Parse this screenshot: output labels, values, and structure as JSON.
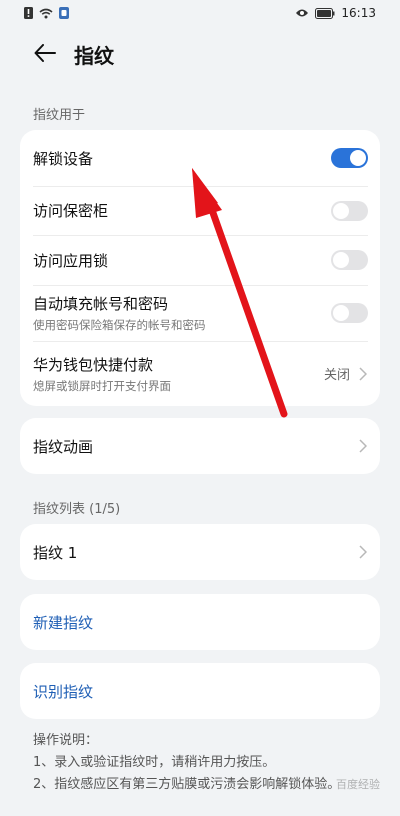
{
  "status_bar": {
    "time": "16:13",
    "left_icons": [
      "alert-icon",
      "wifi-icon",
      "sim-icon"
    ],
    "right_icons": [
      "eye-icon",
      "battery-icon"
    ]
  },
  "header": {
    "title": "指纹",
    "back_icon": "back-arrow-icon"
  },
  "section_use": {
    "label": "指纹用于",
    "items": [
      {
        "title": "解锁设备",
        "subtitle": "",
        "toggle": "on"
      },
      {
        "title": "访问保密柜",
        "subtitle": "",
        "toggle": "off"
      },
      {
        "title": "访问应用锁",
        "subtitle": "",
        "toggle": "off"
      },
      {
        "title": "自动填充帐号和密码",
        "subtitle": "使用密码保险箱保存的帐号和密码",
        "toggle": "off"
      },
      {
        "title": "华为钱包快捷付款",
        "subtitle": "熄屏或锁屏时打开支付界面",
        "value": "关闭"
      }
    ]
  },
  "animation_item": {
    "title": "指纹动画"
  },
  "section_list": {
    "label": "指纹列表 (1/5)",
    "items": [
      {
        "title": "指纹 1"
      }
    ]
  },
  "new_fingerprint": {
    "title": "新建指纹"
  },
  "identify_fingerprint": {
    "title": "识别指纹"
  },
  "notes": {
    "heading": "操作说明：",
    "lines": [
      "1、录入或验证指纹时，请稍许用力按压。",
      "2、指纹感应区有第三方贴膜或污渍会影响解锁体验。"
    ]
  },
  "watermark": "百度经验",
  "colors": {
    "background": "#f1f3f5",
    "card": "#ffffff",
    "accent": "#2a73d9",
    "link": "#1f5fb5",
    "annotation_arrow": "#e3141a"
  }
}
